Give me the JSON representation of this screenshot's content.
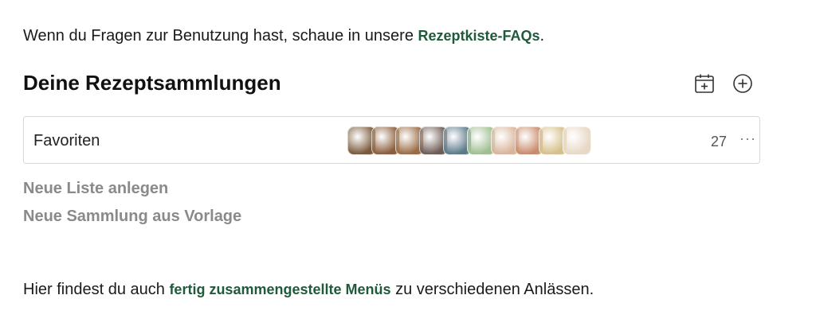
{
  "intro": {
    "text_before": "Wenn du Fragen zur Benutzung hast, schaue in unsere ",
    "link_label": "Rezeptkiste-FAQs",
    "text_after": "."
  },
  "collections": {
    "heading": "Deine Rezeptsammlungen",
    "icons": {
      "calendar_add": "calendar-plus-icon",
      "add": "plus-circle-icon"
    },
    "items": [
      {
        "title": "Favoriten",
        "count": "27",
        "more_label": "···",
        "thumbnail_colors": [
          "#7a5a3a",
          "#8b5e3c",
          "#9a6b45",
          "#6e5b56",
          "#5c7a8a",
          "#9fbf8f",
          "#d9b49a",
          "#c98b6b",
          "#d6c08a",
          "#e8d8c6"
        ]
      }
    ],
    "new_list_label": "Neue Liste anlegen",
    "new_from_template_label": "Neue Sammlung aus Vorlage"
  },
  "footer": {
    "text_before": "Hier findest du auch ",
    "link_label": "fertig zusammengestellte Menüs",
    "text_after": " zu verschiedenen Anlässen."
  },
  "colors": {
    "link": "#1f5a3a",
    "muted": "#8a8a8a",
    "border": "#d8d8d8"
  }
}
